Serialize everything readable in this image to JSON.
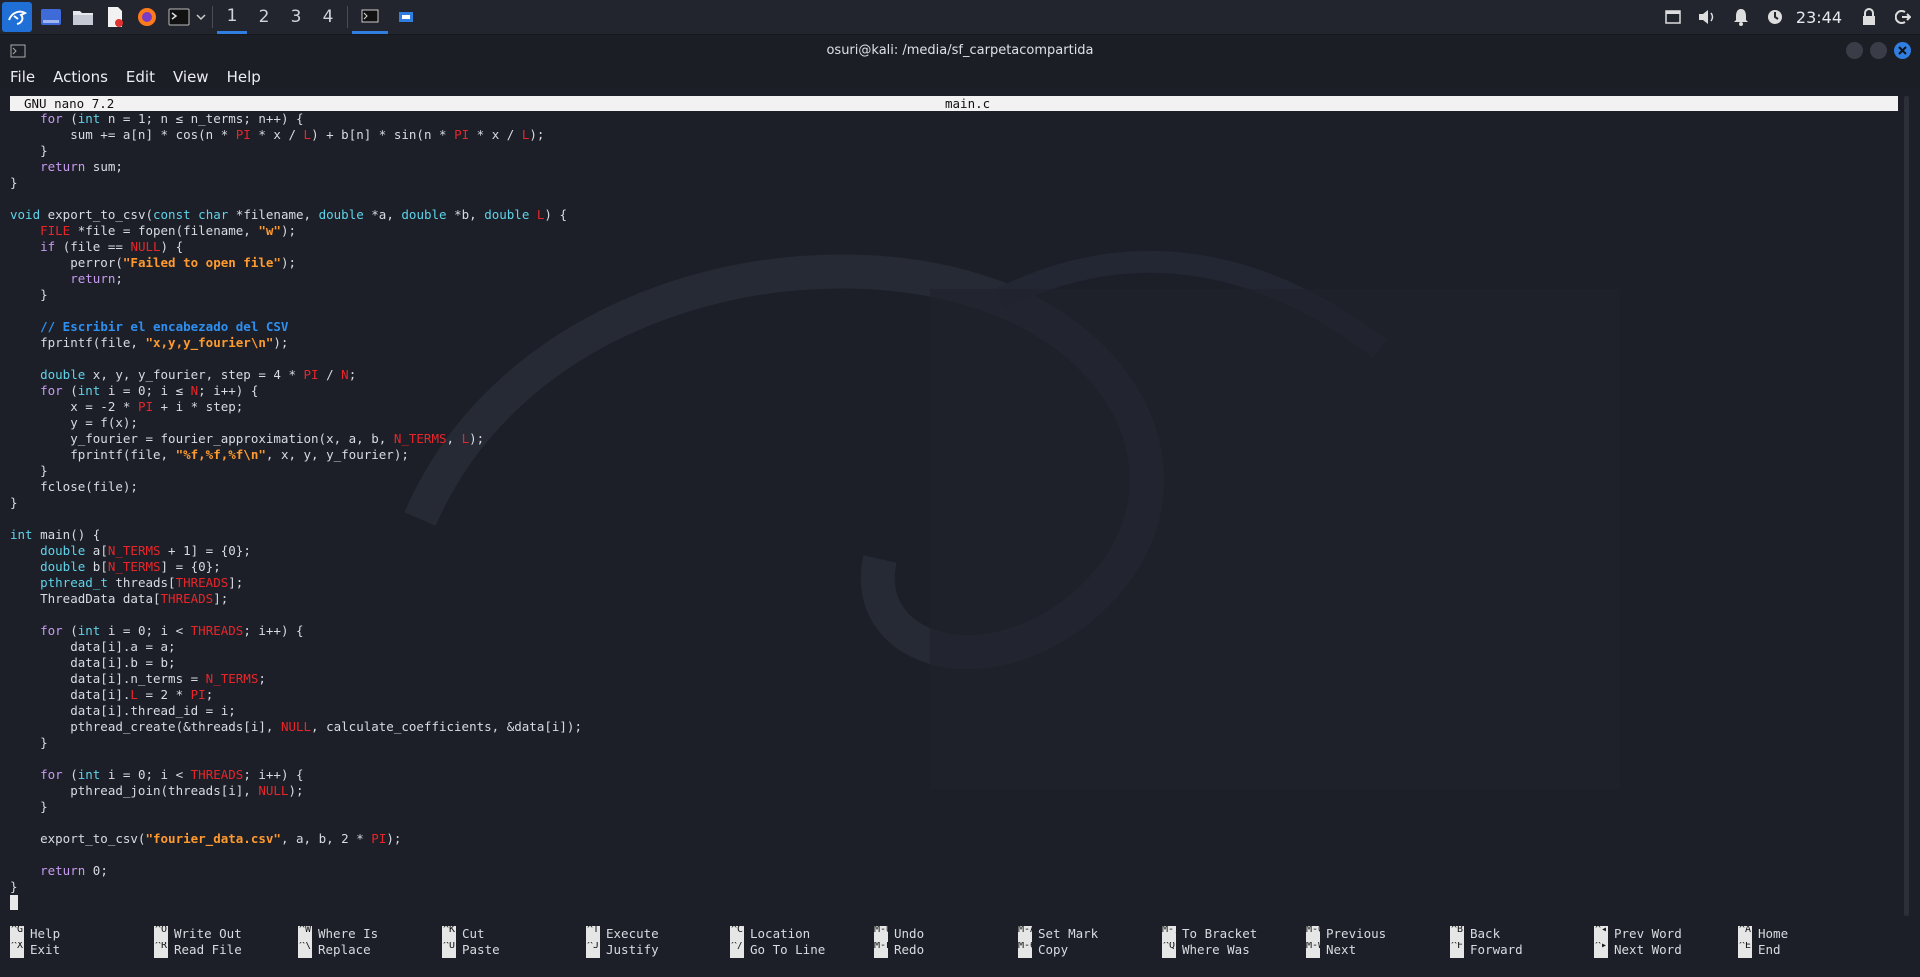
{
  "taskbar": {
    "workspaces": [
      "1",
      "2",
      "3",
      "4"
    ],
    "active_workspace": "1",
    "clock": "23:44",
    "launchers": [
      "kali-menu-icon",
      "desktop-icon",
      "file-manager-icon",
      "text-editor-icon",
      "firefox-icon",
      "terminal-icon"
    ],
    "tray": [
      "screen-icon",
      "volume-icon",
      "notification-bell-icon",
      "power-icon",
      "lock-icon",
      "logout-icon"
    ]
  },
  "window": {
    "title": "osuri@kali: /media/sf_carpetacompartida",
    "menu": [
      "File",
      "Actions",
      "Edit",
      "View",
      "Help"
    ]
  },
  "nano": {
    "version": "GNU nano 7.2",
    "filename": "main.c"
  },
  "code_lines": [
    [
      [
        "    ",
        ""
      ],
      [
        "for",
        "k"
      ],
      [
        " (",
        ""
      ],
      [
        "int",
        "t"
      ],
      [
        " n = 1; n ≤ n_terms; n++) {",
        ""
      ]
    ],
    [
      [
        "        sum += a[n] * cos(n * ",
        ""
      ],
      [
        "PI",
        "m"
      ],
      [
        " * x / ",
        ""
      ],
      [
        "L",
        "m"
      ],
      [
        ") + b[n] * sin(n * ",
        ""
      ],
      [
        "PI",
        "m"
      ],
      [
        " * x / ",
        ""
      ],
      [
        "L",
        "m"
      ],
      [
        ");",
        ""
      ]
    ],
    [
      [
        "    }",
        ""
      ]
    ],
    [
      [
        "    ",
        ""
      ],
      [
        "return",
        "k"
      ],
      [
        " sum;",
        ""
      ]
    ],
    [
      [
        "}",
        ""
      ]
    ],
    [
      [
        "",
        ""
      ]
    ],
    [
      [
        "void",
        "t"
      ],
      [
        " export_to_csv(",
        ""
      ],
      [
        "const",
        "t"
      ],
      [
        " ",
        ""
      ],
      [
        "char",
        "t"
      ],
      [
        " *filename, ",
        ""
      ],
      [
        "double",
        "t"
      ],
      [
        " *a, ",
        ""
      ],
      [
        "double",
        "t"
      ],
      [
        " *b, ",
        ""
      ],
      [
        "double",
        "t"
      ],
      [
        " ",
        ""
      ],
      [
        "L",
        "m"
      ],
      [
        ") {",
        ""
      ]
    ],
    [
      [
        "    ",
        ""
      ],
      [
        "FILE",
        "m"
      ],
      [
        " *file = fopen(filename, ",
        ""
      ],
      [
        "\"w\"",
        "s"
      ],
      [
        ");",
        ""
      ]
    ],
    [
      [
        "    ",
        ""
      ],
      [
        "if",
        "k"
      ],
      [
        " (file == ",
        ""
      ],
      [
        "NULL",
        "m"
      ],
      [
        ") {",
        ""
      ]
    ],
    [
      [
        "        perror(",
        ""
      ],
      [
        "\"Failed to open file\"",
        "s"
      ],
      [
        ");",
        ""
      ]
    ],
    [
      [
        "        ",
        ""
      ],
      [
        "return",
        "k"
      ],
      [
        ";",
        ""
      ]
    ],
    [
      [
        "    }",
        ""
      ]
    ],
    [
      [
        "",
        ""
      ]
    ],
    [
      [
        "    ",
        ""
      ],
      [
        "// Escribir el encabezado del CSV",
        "c"
      ]
    ],
    [
      [
        "    fprintf(file, ",
        ""
      ],
      [
        "\"x,y,y_fourier\\n\"",
        "s"
      ],
      [
        ");",
        ""
      ]
    ],
    [
      [
        "",
        ""
      ]
    ],
    [
      [
        "    ",
        ""
      ],
      [
        "double",
        "t"
      ],
      [
        " x, y, y_fourier, step = 4 * ",
        ""
      ],
      [
        "PI",
        "m"
      ],
      [
        " / ",
        ""
      ],
      [
        "N",
        "m"
      ],
      [
        ";",
        ""
      ]
    ],
    [
      [
        "    ",
        ""
      ],
      [
        "for",
        "k"
      ],
      [
        " (",
        ""
      ],
      [
        "int",
        "t"
      ],
      [
        " i = 0; i ≤ ",
        ""
      ],
      [
        "N",
        "m"
      ],
      [
        "; i++) {",
        ""
      ]
    ],
    [
      [
        "        x = -2 * ",
        ""
      ],
      [
        "PI",
        "m"
      ],
      [
        " + i * step;",
        ""
      ]
    ],
    [
      [
        "        y = f(x);",
        ""
      ]
    ],
    [
      [
        "        y_fourier = fourier_approximation(x, a, b, ",
        ""
      ],
      [
        "N_TERMS",
        "m"
      ],
      [
        ", ",
        ""
      ],
      [
        "L",
        "m"
      ],
      [
        ");",
        ""
      ]
    ],
    [
      [
        "        fprintf(file, ",
        ""
      ],
      [
        "\"%f,%f,%f\\n\"",
        "s"
      ],
      [
        ", x, y, y_fourier);",
        ""
      ]
    ],
    [
      [
        "    }",
        ""
      ]
    ],
    [
      [
        "    fclose(file);",
        ""
      ]
    ],
    [
      [
        "}",
        ""
      ]
    ],
    [
      [
        "",
        ""
      ]
    ],
    [
      [
        "int",
        "t"
      ],
      [
        " main() {",
        ""
      ]
    ],
    [
      [
        "    ",
        ""
      ],
      [
        "double",
        "t"
      ],
      [
        " a[",
        ""
      ],
      [
        "N_TERMS",
        "m"
      ],
      [
        " + 1] = {0};",
        ""
      ]
    ],
    [
      [
        "    ",
        ""
      ],
      [
        "double",
        "t"
      ],
      [
        " b[",
        ""
      ],
      [
        "N_TERMS",
        "m"
      ],
      [
        "] = {0};",
        ""
      ]
    ],
    [
      [
        "    ",
        ""
      ],
      [
        "pthread_t",
        "t"
      ],
      [
        " threads[",
        ""
      ],
      [
        "THREADS",
        "m"
      ],
      [
        "];",
        ""
      ]
    ],
    [
      [
        "    ThreadData data[",
        ""
      ],
      [
        "THREADS",
        "m"
      ],
      [
        "];",
        ""
      ]
    ],
    [
      [
        "",
        ""
      ]
    ],
    [
      [
        "    ",
        ""
      ],
      [
        "for",
        "k"
      ],
      [
        " (",
        ""
      ],
      [
        "int",
        "t"
      ],
      [
        " i = 0; i < ",
        ""
      ],
      [
        "THREADS",
        "m"
      ],
      [
        "; i++) {",
        ""
      ]
    ],
    [
      [
        "        data[i].a = a;",
        ""
      ]
    ],
    [
      [
        "        data[i].b = b;",
        ""
      ]
    ],
    [
      [
        "        data[i].n_terms = ",
        ""
      ],
      [
        "N_TERMS",
        "m"
      ],
      [
        ";",
        ""
      ]
    ],
    [
      [
        "        data[i].",
        ""
      ],
      [
        "L",
        "m"
      ],
      [
        " = 2 * ",
        ""
      ],
      [
        "PI",
        "m"
      ],
      [
        ";",
        ""
      ]
    ],
    [
      [
        "        data[i].thread_id = i;",
        ""
      ]
    ],
    [
      [
        "        pthread_create(&threads[i], ",
        ""
      ],
      [
        "NULL",
        "m"
      ],
      [
        ", calculate_coefficients, &data[i]);",
        ""
      ]
    ],
    [
      [
        "    }",
        ""
      ]
    ],
    [
      [
        "",
        ""
      ]
    ],
    [
      [
        "    ",
        ""
      ],
      [
        "for",
        "k"
      ],
      [
        " (",
        ""
      ],
      [
        "int",
        "t"
      ],
      [
        " i = 0; i < ",
        ""
      ],
      [
        "THREADS",
        "m"
      ],
      [
        "; i++) {",
        ""
      ]
    ],
    [
      [
        "        pthread_join(threads[i], ",
        ""
      ],
      [
        "NULL",
        "m"
      ],
      [
        ");",
        ""
      ]
    ],
    [
      [
        "    }",
        ""
      ]
    ],
    [
      [
        "",
        ""
      ]
    ],
    [
      [
        "    export_to_csv(",
        ""
      ],
      [
        "\"fourier_data.csv\"",
        "s"
      ],
      [
        ", a, b, 2 * ",
        ""
      ],
      [
        "PI",
        "m"
      ],
      [
        ");",
        ""
      ]
    ],
    [
      [
        "",
        ""
      ]
    ],
    [
      [
        "    ",
        ""
      ],
      [
        "return",
        "k"
      ],
      [
        " 0;",
        ""
      ]
    ],
    [
      [
        "}",
        ""
      ]
    ]
  ],
  "shortcuts": [
    [
      [
        "^G",
        "Help"
      ],
      [
        "^X",
        "Exit"
      ]
    ],
    [
      [
        "^O",
        "Write Out"
      ],
      [
        "^R",
        "Read File"
      ]
    ],
    [
      [
        "^W",
        "Where Is"
      ],
      [
        "^\\",
        "Replace"
      ]
    ],
    [
      [
        "^K",
        "Cut"
      ],
      [
        "^U",
        "Paste"
      ]
    ],
    [
      [
        "^T",
        "Execute"
      ],
      [
        "^J",
        "Justify"
      ]
    ],
    [
      [
        "^C",
        "Location"
      ],
      [
        "^/",
        "Go To Line"
      ]
    ],
    [
      [
        "M-U",
        "Undo"
      ],
      [
        "M-E",
        "Redo"
      ]
    ],
    [
      [
        "M-A",
        "Set Mark"
      ],
      [
        "M-6",
        "Copy"
      ]
    ],
    [
      [
        "M-]",
        "To Bracket"
      ],
      [
        "^Q",
        "Where Was"
      ]
    ],
    [
      [
        "M-Q",
        "Previous"
      ],
      [
        "M-W",
        "Next"
      ]
    ],
    [
      [
        "^B",
        "Back"
      ],
      [
        "^F",
        "Forward"
      ]
    ],
    [
      [
        "^◂",
        "Prev Word"
      ],
      [
        "^▸",
        "Next Word"
      ]
    ],
    [
      [
        "^A",
        "Home"
      ],
      [
        "^E",
        "End"
      ]
    ]
  ],
  "colors": {
    "keyword": "#c79bf0",
    "type": "#5fd3ea",
    "macro": "#e8262a",
    "string": "#ff9a2e",
    "comment": "#2f8ff0",
    "accent": "#2f7ee0"
  }
}
